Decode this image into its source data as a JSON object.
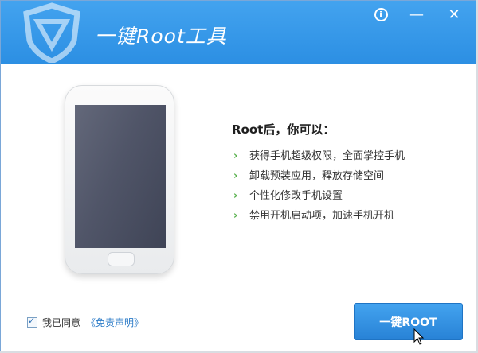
{
  "window": {
    "title": "一键Root工具",
    "controls": {
      "info": "i",
      "minimize": "—",
      "close": "✕"
    }
  },
  "features": {
    "title": "Root后，你可以：",
    "items": [
      "获得手机超级权限，全面掌控手机",
      "卸载预装应用，释放存储空间",
      "个性化修改手机设置",
      "禁用开机启动项，加速手机开机"
    ],
    "bullet": "›"
  },
  "agreement": {
    "checked": true,
    "label": "我已同意",
    "link": "《免责声明》"
  },
  "root_button": {
    "label": "一键ROOT"
  },
  "colors": {
    "brand": "#2c8fe3",
    "bullet": "#58b14d",
    "link": "#2d7cc8"
  }
}
